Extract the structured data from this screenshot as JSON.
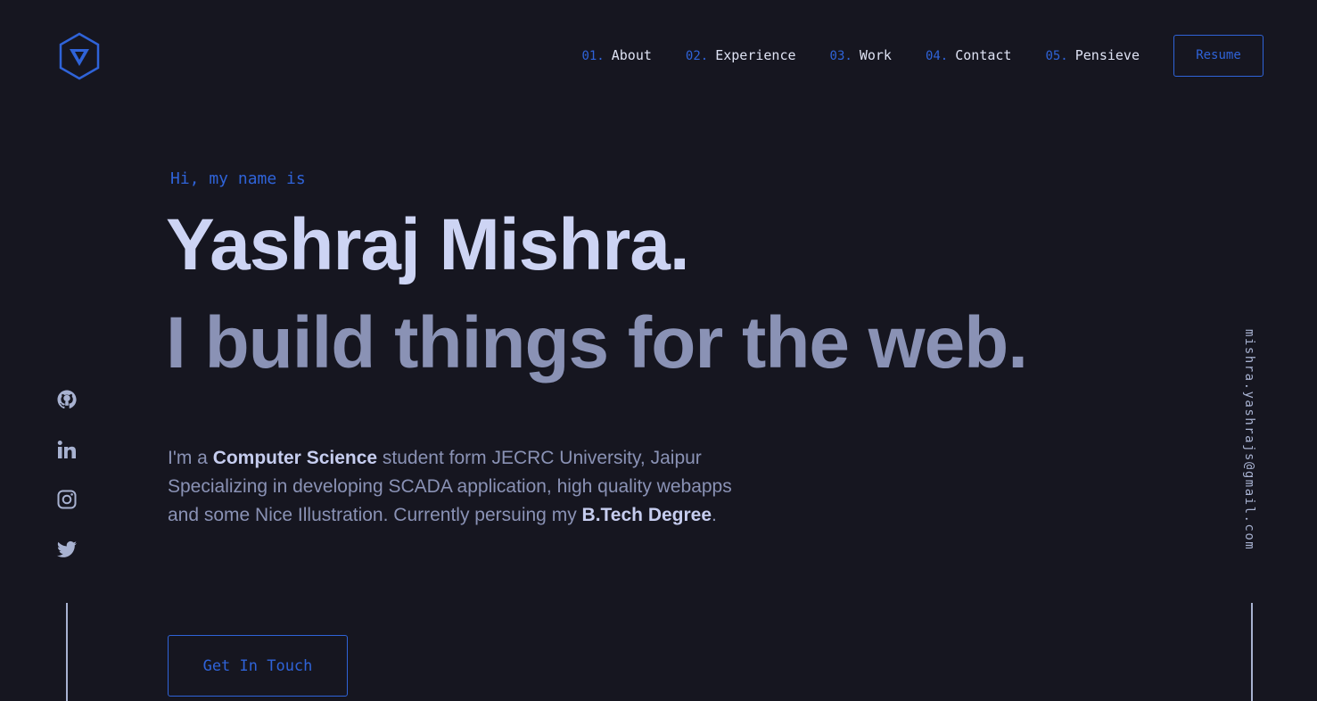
{
  "header": {
    "logo_icon": "hexagon-v-logo-icon",
    "nav": [
      {
        "num": "01.",
        "label": "About"
      },
      {
        "num": "02.",
        "label": "Experience"
      },
      {
        "num": "03.",
        "label": "Work"
      },
      {
        "num": "04.",
        "label": "Contact"
      },
      {
        "num": "05.",
        "label": "Pensieve"
      }
    ],
    "resume_label": "Resume"
  },
  "hero": {
    "intro": "Hi, my name is",
    "name": "Yashraj Mishra.",
    "tagline": "I build things for the web.",
    "bio": {
      "p1": "I'm a ",
      "b1": "Computer Science",
      "p2": " student form JECRC University, Jaipur Specializing in developing SCADA application, high quality webapps and some Nice Illustration. Currently persuing my ",
      "b2": "B.Tech Degree",
      "p3": "."
    },
    "cta_label": "Get In Touch"
  },
  "social": [
    "github-icon",
    "linkedin-icon",
    "instagram-icon",
    "twitter-icon"
  ],
  "email": "mishra.yashrajs@gmail.com",
  "colors": {
    "background": "#161620",
    "accent": "#2f63d8",
    "heading": "#cdd4f4",
    "text": "#8a92b5"
  }
}
